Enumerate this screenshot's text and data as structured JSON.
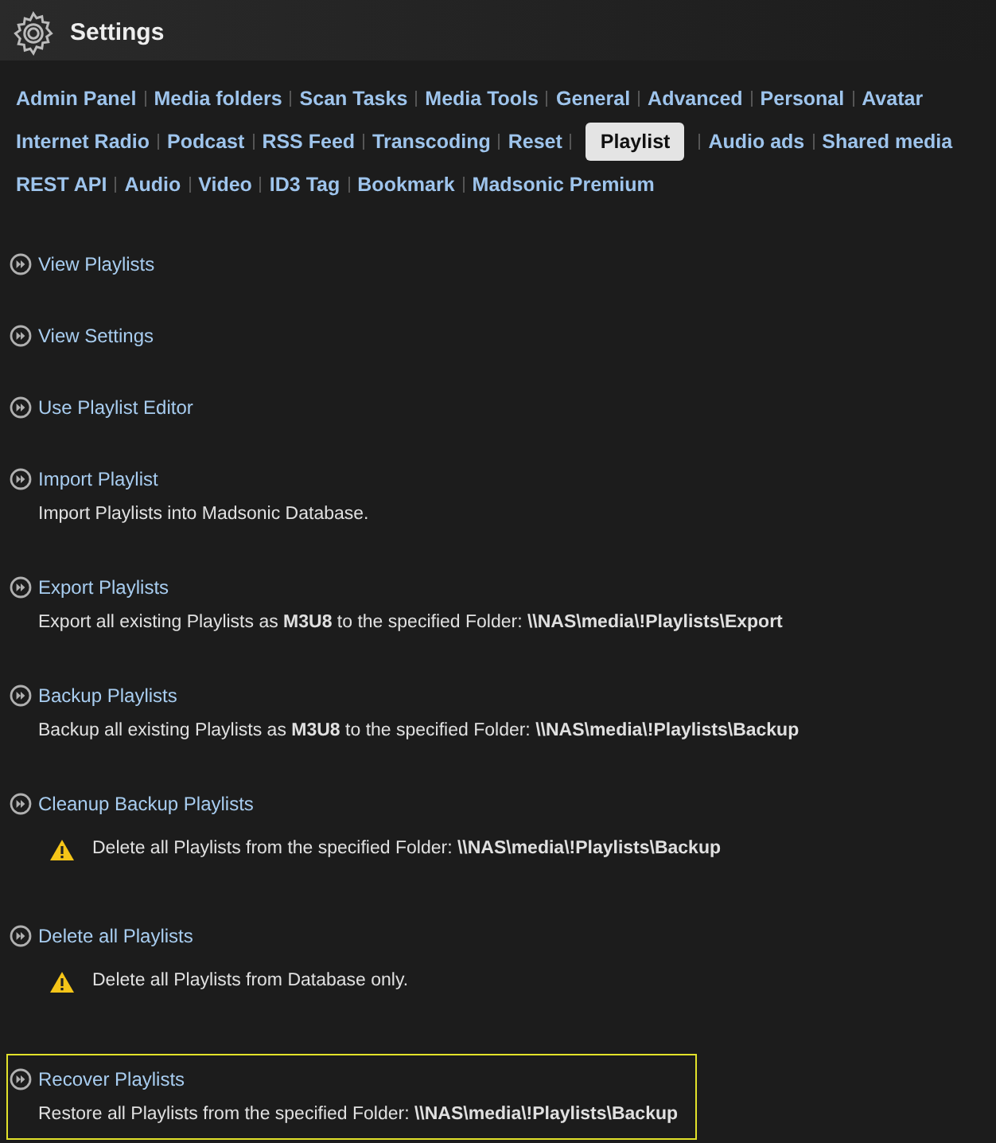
{
  "header": {
    "title": "Settings"
  },
  "nav_rows": [
    [
      {
        "label": "Admin Panel",
        "selected": false
      },
      {
        "label": "Media folders",
        "selected": false
      },
      {
        "label": "Scan Tasks",
        "selected": false
      },
      {
        "label": "Media Tools",
        "selected": false
      },
      {
        "label": "General",
        "selected": false
      },
      {
        "label": "Advanced",
        "selected": false
      },
      {
        "label": "Personal",
        "selected": false
      },
      {
        "label": "Avatar",
        "selected": false
      }
    ],
    [
      {
        "label": "Internet Radio",
        "selected": false
      },
      {
        "label": "Podcast",
        "selected": false
      },
      {
        "label": "RSS Feed",
        "selected": false
      },
      {
        "label": "Transcoding",
        "selected": false
      },
      {
        "label": "Reset",
        "selected": false
      },
      {
        "label": "Playlist",
        "selected": true
      },
      {
        "label": "Audio ads",
        "selected": false
      },
      {
        "label": "Shared media",
        "selected": false
      }
    ],
    [
      {
        "label": "REST API",
        "selected": false
      },
      {
        "label": "Audio",
        "selected": false
      },
      {
        "label": "Video",
        "selected": false
      },
      {
        "label": "ID3 Tag",
        "selected": false
      },
      {
        "label": "Bookmark",
        "selected": false
      },
      {
        "label": "Madsonic Premium",
        "selected": false
      }
    ]
  ],
  "sections": [
    {
      "title": "View Playlists",
      "highlighted": false
    },
    {
      "title": "View Settings",
      "highlighted": false
    },
    {
      "title": "Use Playlist Editor",
      "highlighted": false
    },
    {
      "title": "Import Playlist",
      "highlighted": false,
      "note": {
        "kind": "info",
        "text": "Import Playlists into Madsonic Database."
      }
    },
    {
      "title": "Export Playlists",
      "highlighted": false,
      "note": {
        "kind": "info",
        "text": "Export all existing Playlists as **M3U8** to the specified Folder: **\\\\NAS\\media\\!Playlists\\Export**"
      }
    },
    {
      "title": "Backup Playlists",
      "highlighted": false,
      "note": {
        "kind": "info",
        "text": "Backup all existing Playlists as **M3U8** to the specified Folder: **\\\\NAS\\media\\!Playlists\\Backup**"
      }
    },
    {
      "title": "Cleanup Backup Playlists",
      "highlighted": false,
      "note": {
        "kind": "warning",
        "text": "Delete all Playlists from the specified Folder: **\\\\NAS\\media\\!Playlists\\Backup**"
      }
    },
    {
      "title": "Delete all Playlists",
      "highlighted": false,
      "note": {
        "kind": "warning",
        "text": "Delete all Playlists from Database only."
      }
    },
    {
      "title": "Recover Playlists",
      "highlighted": true,
      "note": {
        "kind": "info",
        "text": "Restore all Playlists from the specified Folder: **\\\\NAS\\media\\!Playlists\\Backup**"
      }
    }
  ]
}
